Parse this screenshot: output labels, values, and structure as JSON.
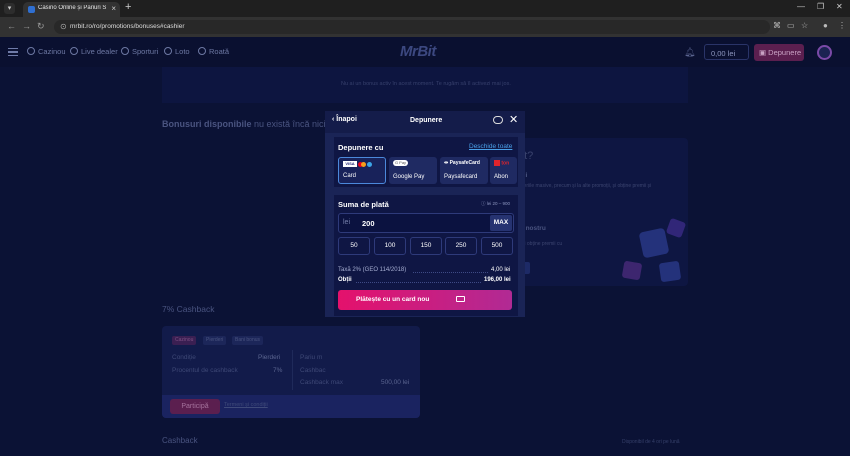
{
  "browser": {
    "tab_title": "Casino Online și Pariuri Sportive",
    "url": "mrbit.ro/ro/promotions/bonuses#cashier"
  },
  "site": {
    "logo": "MrBit",
    "nav": [
      "Cazinou",
      "Live dealer",
      "Sporturi",
      "Loto",
      "Roată"
    ],
    "balance": "0,00 lei",
    "deposit_label": "Depunere"
  },
  "page": {
    "notice": "Nu ai un bonus activ în acest moment. Te rugăm să îl activezi mai jos.",
    "bonus_title": "Bonusuri disponibile",
    "bonus_sub": "nu există încă niciun bo",
    "right_title": "nt?",
    "right_t1": "eții",
    "right_t2": "ageriile masive, precum și la alte promoții, și obține premii și",
    "right_t3": "i",
    "right_t4": "ul nostru",
    "right_t5": "ți și obține premii cu",
    "cashback_title": "7% Cashback",
    "chips": [
      "Cazinou",
      "Pierderi",
      "Bani bonus"
    ],
    "rows": [
      {
        "label": "Condiție",
        "value": "Pierderi"
      },
      {
        "label": "Procentul de cashback",
        "value": "7%"
      }
    ],
    "rows_right": [
      "Pariu m",
      "Cashbac",
      "Cashback max"
    ],
    "cashback_max": "500,00 lei",
    "join_label": "Participă",
    "terms_label": "Termeni și condiții",
    "cashback_section": "Cashback",
    "available": "Disponibil de 4 ori pe lună"
  },
  "modal": {
    "back_label": "Înapoi",
    "title": "Depunere",
    "deposit_with": "Depunere cu",
    "open_all": "Deschide toate",
    "methods": [
      {
        "name": "Card",
        "selected": true
      },
      {
        "name": "Google Pay",
        "logo": "G Pay"
      },
      {
        "name": "Paysafecard",
        "logo": "PaysafeCard"
      },
      {
        "name": "Abon",
        "logo": "ton"
      }
    ],
    "amount_title": "Suma de plată",
    "amount_range": "lei 20 – 900",
    "currency": "lei",
    "amount": "200",
    "max_label": "MAX",
    "quick": [
      "50",
      "100",
      "150",
      "250",
      "500"
    ],
    "fee_label": "Taxă 2% (GEO 114/2018)",
    "fee_value": "4,00 lei",
    "get_label": "Obții",
    "get_value": "196,00 lei",
    "pay_label": "Plătește cu un card nou"
  },
  "colors": {
    "page_bg": "#0b1235",
    "modal_bg": "#1a2456",
    "accent_pink": "#e4116c",
    "link_blue": "#4aa0e8"
  }
}
